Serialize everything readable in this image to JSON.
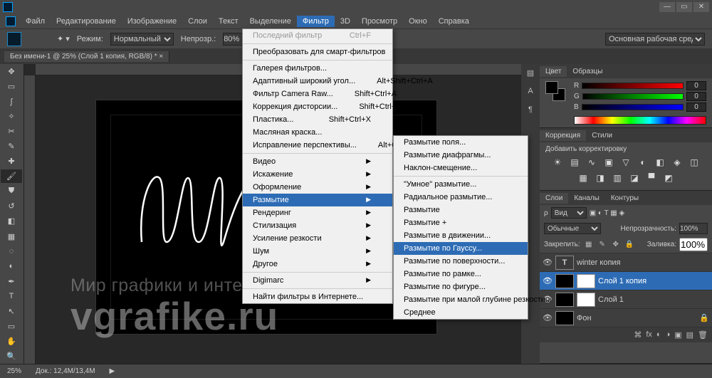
{
  "menubar": [
    "Файл",
    "Редактирование",
    "Изображение",
    "Слои",
    "Текст",
    "Выделение",
    "Фильтр",
    "3D",
    "Просмотр",
    "Окно",
    "Справка"
  ],
  "menubar_active": 6,
  "optionsbar": {
    "mode_label": "Режим:",
    "mode_value": "Нормальный",
    "opacity_label": "Непрозр.:",
    "opacity_value": "80%",
    "workspace_label": "Основная рабочая среда"
  },
  "document_tab": "Без имени-1 @ 25% (Слой 1 копия, RGB/8) *",
  "filter_menu": {
    "last": "Последний фильтр",
    "last_key": "Ctrl+F",
    "smart": "Преобразовать для смарт-фильтров",
    "gallery": "Галерея фильтров...",
    "wide": "Адаптивный широкий угол...",
    "wide_key": "Alt+Shift+Ctrl+A",
    "camera": "Фильтр Camera Raw...",
    "camera_key": "Shift+Ctrl+A",
    "lens": "Коррекция дисторсии...",
    "lens_key": "Shift+Ctrl+R",
    "liquify": "Пластика...",
    "liquify_key": "Shift+Ctrl+X",
    "oil": "Масляная краска...",
    "vanish": "Исправление перспективы...",
    "vanish_key": "Alt+Ctrl+V",
    "video": "Видео",
    "distort": "Искажение",
    "decor": "Оформление",
    "blur": "Размытие",
    "render": "Рендеринг",
    "stylize": "Стилизация",
    "sharpen": "Усиление резкости",
    "noise": "Шум",
    "other": "Другое",
    "digimarc": "Digimarc",
    "browse": "Найти фильтры в Интернете..."
  },
  "blur_submenu": {
    "field": "Размытие поля...",
    "iris": "Размытие диафрагмы...",
    "tilt": "Наклон-смещение...",
    "smart": "\"Умное\" размытие...",
    "radial": "Радиальное размытие...",
    "blur": "Размытие",
    "more": "Размытие +",
    "motion": "Размытие в движении...",
    "gauss": "Размытие по Гауссу...",
    "surface": "Размытие по поверхности...",
    "box": "Размытие по рамке...",
    "shape": "Размытие по фигуре...",
    "lens": "Размытие при малой глубине резкости...",
    "average": "Среднее"
  },
  "color_panel": {
    "tab1": "Цвет",
    "tab2": "Образцы",
    "r": "R",
    "g": "G",
    "b": "B",
    "val": "0"
  },
  "adjust_panel": {
    "tab1": "Коррекция",
    "tab2": "Стили",
    "add": "Добавить корректировку"
  },
  "layers_panel": {
    "tab1": "Слои",
    "tab2": "Каналы",
    "tab3": "Контуры",
    "filter_label": "Вид",
    "blend_value": "Обычные",
    "opacity_label": "Непрозрачность:",
    "opacity_value": "100%",
    "lock_label": "Закрепить:",
    "fill_label": "Заливка:",
    "fill_value": "100%",
    "layers": [
      {
        "name": "winter копия",
        "type": "text"
      },
      {
        "name": "Слой 1 копия",
        "type": "raster",
        "active": true
      },
      {
        "name": "Слой 1",
        "type": "raster"
      },
      {
        "name": "Фон",
        "type": "bg"
      }
    ]
  },
  "status": {
    "zoom": "25%",
    "doc": "Док.: 12,4M/13,4M"
  },
  "watermark1": "Мир графики и интернета",
  "watermark2": "vgrafike.ru"
}
